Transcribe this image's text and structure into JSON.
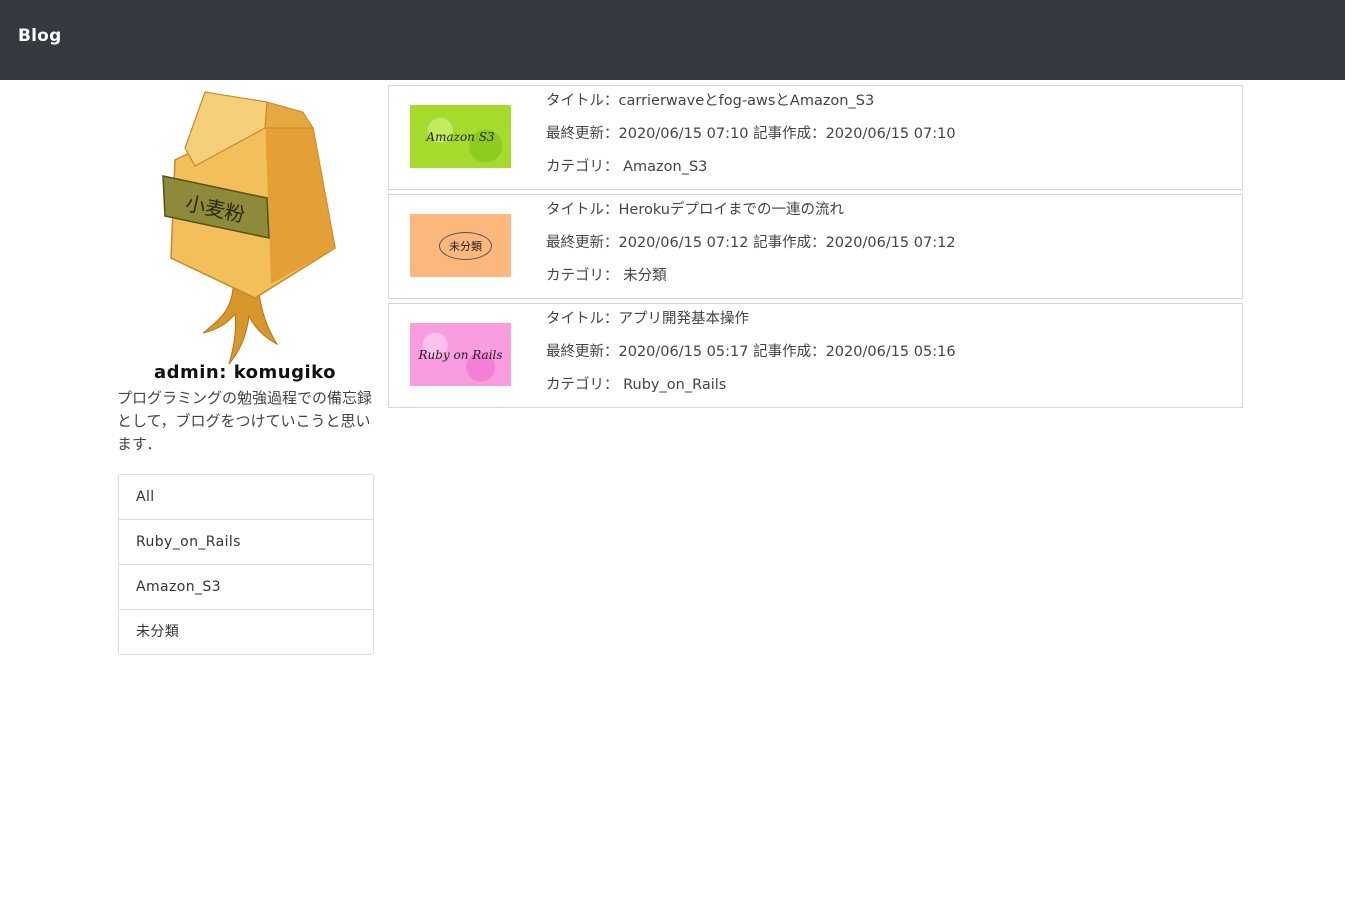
{
  "navbar": {
    "brand": "Blog"
  },
  "profile": {
    "avatar_icon": "flour-bag-illustration",
    "avatar_label": "小麦粉",
    "admin_name": "admin: komugiko",
    "description": "プログラミングの勉強過程での備忘録として，ブログをつけていこうと思います．"
  },
  "categories": [
    {
      "label": "All"
    },
    {
      "label": "Ruby_on_Rails"
    },
    {
      "label": "Amazon_S3"
    },
    {
      "label": "未分類"
    }
  ],
  "posts": [
    {
      "thumb_text": "Amazon S3",
      "thumb_color": "#a6db2e",
      "title": "タイトル：carrierwaveとfog-awsとAmazon_S3",
      "dates": "最終更新：2020/06/15 07:10 記事作成：2020/06/15 07:10",
      "category": "カテゴリ：  Amazon_S3"
    },
    {
      "thumb_text": "未分類",
      "thumb_color": "#fcb77c",
      "title": "タイトル：Herokuデプロイまでの一連の流れ",
      "dates": "最終更新：2020/06/15 07:12 記事作成：2020/06/15 07:12",
      "category": "カテゴリ：  未分類"
    },
    {
      "thumb_text": "Ruby on Rails",
      "thumb_color": "#f99de0",
      "title": "タイトル：アプリ開発基本操作",
      "dates": "最終更新：2020/06/15 05:17 記事作成：2020/06/15 05:16",
      "category": "カテゴリ：  Ruby_on_Rails"
    }
  ]
}
